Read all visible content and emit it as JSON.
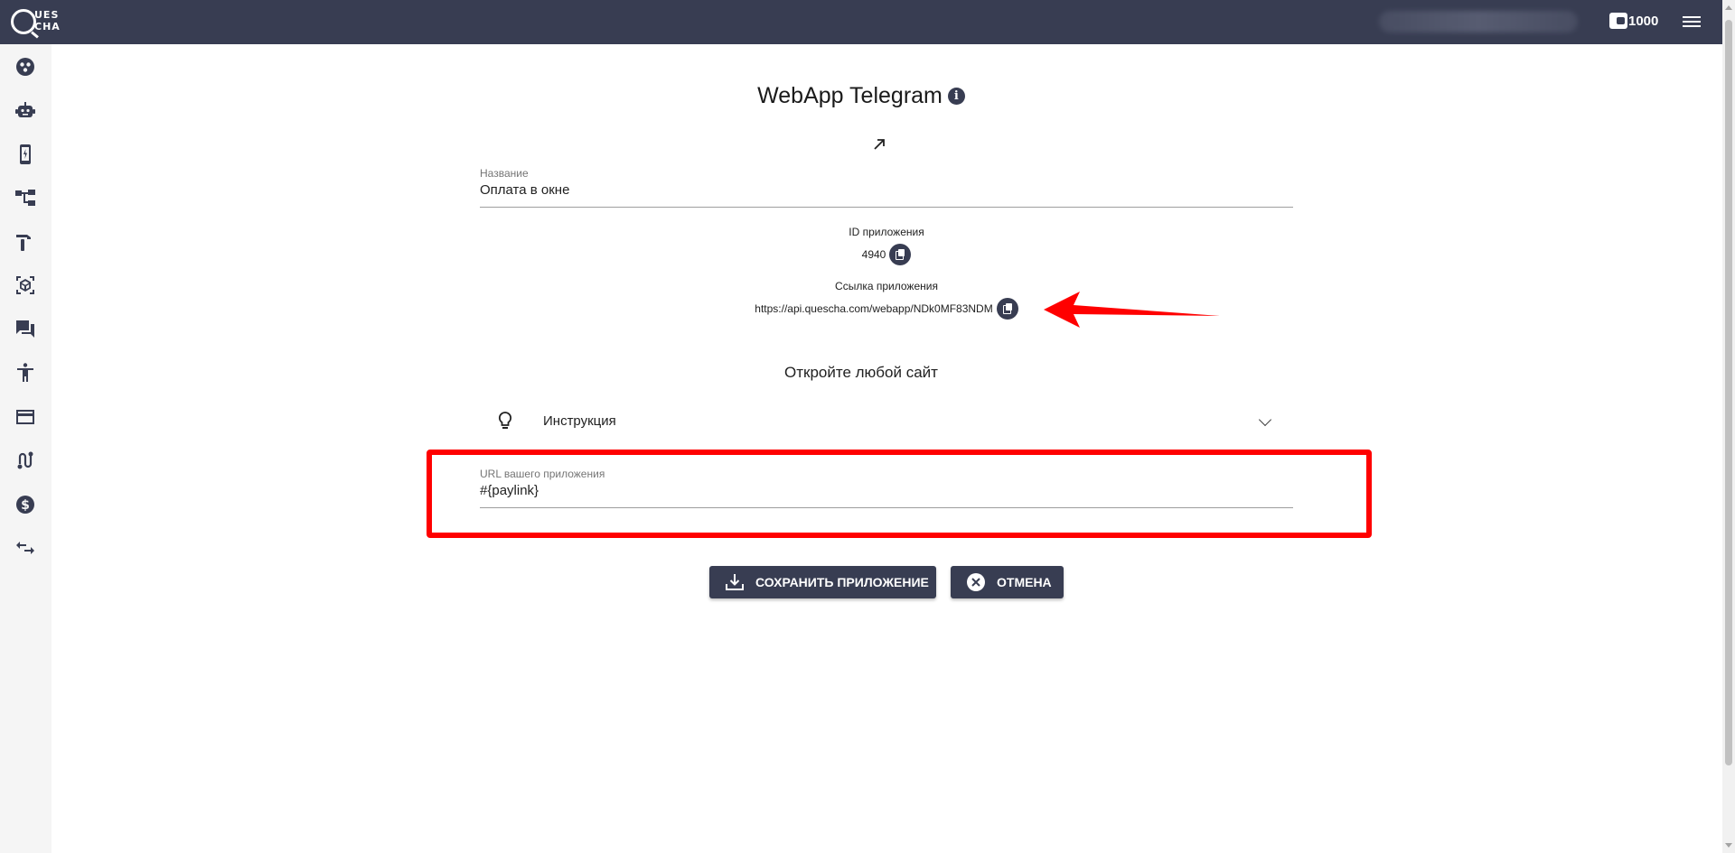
{
  "topbar": {
    "logo_line1": "UES",
    "logo_line2": "CHA",
    "balance": "1000"
  },
  "sidebar": {
    "items": [
      {
        "name": "sidebar-item-dashboard",
        "icon": "bubble-chart-icon"
      },
      {
        "name": "sidebar-item-bots",
        "icon": "robot-icon"
      },
      {
        "name": "sidebar-item-apps",
        "icon": "mobile-icon"
      },
      {
        "name": "sidebar-item-flows",
        "icon": "account-tree-icon"
      },
      {
        "name": "sidebar-item-tools",
        "icon": "hammer-icon"
      },
      {
        "name": "sidebar-item-products",
        "icon": "cube-scan-icon"
      },
      {
        "name": "sidebar-item-chats",
        "icon": "forum-icon"
      },
      {
        "name": "sidebar-item-accessibility",
        "icon": "accessibility-icon"
      },
      {
        "name": "sidebar-item-payments",
        "icon": "credit-card-icon"
      },
      {
        "name": "sidebar-item-routes",
        "icon": "route-icon"
      },
      {
        "name": "sidebar-item-finance",
        "icon": "dollar-icon"
      },
      {
        "name": "sidebar-item-transfers",
        "icon": "swap-icon"
      }
    ]
  },
  "main": {
    "title": "WebApp Telegram",
    "name_field": {
      "label": "Название",
      "value": "Оплата в окне"
    },
    "app_id": {
      "label": "ID приложения",
      "value": "4940"
    },
    "app_link": {
      "label": "Ссылка приложения",
      "value": "https://api.quescha.com/webapp/NDk0MF83NDM"
    },
    "sub_heading": "Откройте любой сайт",
    "accordion_label": "Инструкция",
    "url_field": {
      "label": "URL вашего приложения",
      "value": "#{paylink}"
    },
    "save_label": "СОХРАНИТЬ ПРИЛОЖЕНИЕ",
    "cancel_label": "ОТМЕНА"
  },
  "colors": {
    "primary": "#383d52",
    "annotation": "#ff0000"
  }
}
